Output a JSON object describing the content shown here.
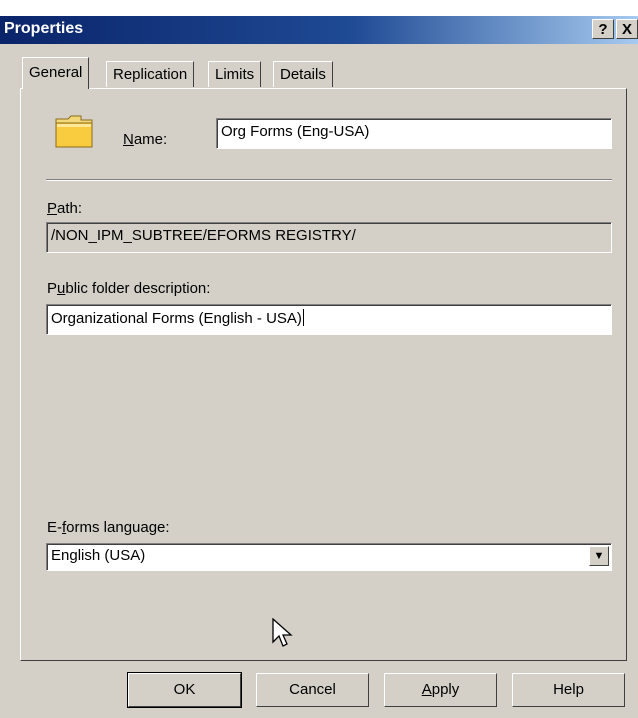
{
  "window": {
    "title": "Properties",
    "help_glyph": "?",
    "close_glyph": "X"
  },
  "tabs": [
    {
      "label": "General",
      "active": true
    },
    {
      "label": "Replication",
      "active": false
    },
    {
      "label": "Limits",
      "active": false
    },
    {
      "label": "Details",
      "active": false
    }
  ],
  "general": {
    "name_label": "Name:",
    "name_value": "Org Forms (Eng-USA)",
    "path_label": "Path:",
    "path_value": "/NON_IPM_SUBTREE/EFORMS REGISTRY/",
    "description_label": "Public folder description:",
    "description_value": "Organizational Forms (English - USA)",
    "language_label": "E-forms language:",
    "language_value": "English (USA)"
  },
  "buttons": {
    "ok": "OK",
    "cancel": "Cancel",
    "apply": "Apply",
    "help": "Help"
  },
  "icons": {
    "folder": "folder-icon",
    "dropdown": "chevron-down-icon",
    "cursor": "mouse-pointer-icon"
  }
}
